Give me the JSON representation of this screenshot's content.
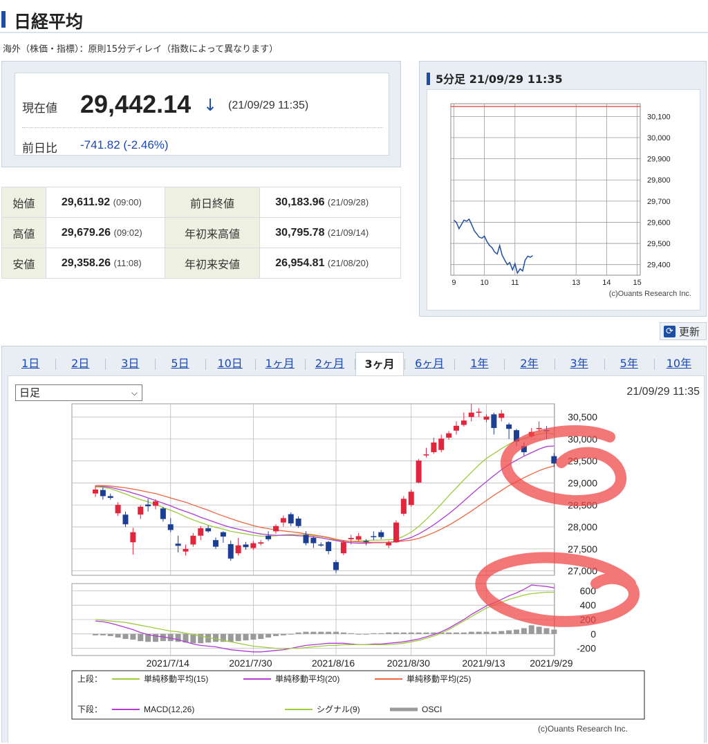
{
  "page": {
    "title": "日経平均",
    "note": "海外（株価・指標）：原則15分ディレイ（指数によって異なります）"
  },
  "quote": {
    "current_label": "現在値",
    "current_value": "29,442.14",
    "arrow": "↓",
    "current_time": "(21/09/29 11:35)",
    "change_label": "前日比",
    "change_value": "-741.82 (-2.46%)"
  },
  "stats": [
    {
      "label1": "始値",
      "value1": "29,611.92",
      "time1": "(09:00)",
      "label2": "前日終値",
      "value2": "30,183.96",
      "time2": "(21/09/28)"
    },
    {
      "label1": "高値",
      "value1": "29,679.26",
      "time1": "(09:02)",
      "label2": "年初来高値",
      "value2": "30,795.78",
      "time2": "(21/09/14)"
    },
    {
      "label1": "安値",
      "value1": "29,358.26",
      "time1": "(11:08)",
      "label2": "年初来安値",
      "value2": "26,954.81",
      "time2": "(21/08/20)"
    }
  ],
  "mini": {
    "heading": "5分足 21/09/29 11:35",
    "credit": "(c)Ouants Research Inc."
  },
  "refresh": {
    "label": "更新",
    "icon": "refresh-icon"
  },
  "tabs": [
    "1日",
    "2日",
    "3日",
    "5日",
    "10日",
    "1ヶ月",
    "2ヶ月",
    "3ヶ月",
    "6ヶ月",
    "1年",
    "2年",
    "3年",
    "5年",
    "10年"
  ],
  "active_tab": "3ヶ月",
  "main": {
    "period_select": "日足",
    "timestamp": "21/09/29 11:35",
    "legend_upper_label": "上段：",
    "legend_lower_label": "下段：",
    "legend_upper": [
      "単純移動平均(15)",
      "単純移動平均(20)",
      "単純移動平均(25)"
    ],
    "legend_lower": [
      "MACD(12,26)",
      "シグナル(9)",
      "OSCI"
    ],
    "credit": "(c)Ouants Research Inc."
  },
  "colors": {
    "up": "#e0253c",
    "down": "#1c3f94",
    "ma15": "#9ccc3c",
    "ma20": "#b13ad6",
    "ma25": "#f06440",
    "osci": "#9a9a9a",
    "annotation": "#f04a4a"
  },
  "chart_data": [
    {
      "type": "line",
      "title": "5分足 21/09/29 11:35",
      "x_ticks": [
        "9",
        "10",
        "11",
        "13",
        "14",
        "15"
      ],
      "y_ticks": [
        "30,100",
        "30,000",
        "29,900",
        "29,800",
        "29,700",
        "29,600",
        "29,500",
        "29,400"
      ],
      "ylim": [
        29350,
        30160
      ],
      "x_range": [
        8.9,
        15.1
      ],
      "reference_line": 30183.96,
      "series": [
        {
          "x": [
            9.0,
            9.08,
            9.17,
            9.25,
            9.33,
            9.42,
            9.5,
            9.58,
            9.67,
            9.75,
            9.83,
            9.92,
            10.0,
            10.08,
            10.17,
            10.25,
            10.33,
            10.42,
            10.5,
            10.58,
            10.67,
            10.75,
            10.83,
            10.92,
            11.0,
            11.08,
            11.17,
            11.25,
            11.33,
            11.42,
            11.5,
            11.58
          ],
          "y": [
            29610,
            29600,
            29570,
            29590,
            29610,
            29605,
            29615,
            29590,
            29560,
            29545,
            29530,
            29525,
            29535,
            29510,
            29490,
            29480,
            29460,
            29450,
            29490,
            29445,
            29420,
            29400,
            29410,
            29375,
            29405,
            29360,
            29380,
            29370,
            29420,
            29440,
            29435,
            29442
          ]
        }
      ]
    },
    {
      "type": "candlestick",
      "period": "日足",
      "x_tick_labels": [
        "2021/7/14",
        "2021/7/30",
        "2021/8/16",
        "2021/8/30",
        "2021/9/13",
        "2021/9/29"
      ],
      "y_ticks": [
        "30,500",
        "30,000",
        "29,500",
        "29,000",
        "28,500",
        "28,000",
        "27,500",
        "27,000"
      ],
      "ylim": [
        26900,
        30800
      ],
      "candles": [
        [
          28760,
          28850,
          28680,
          28940
        ],
        [
          28840,
          28700,
          28620,
          28900
        ],
        [
          28700,
          28660,
          28620,
          28760
        ],
        [
          28310,
          28500,
          28250,
          28560
        ],
        [
          28280,
          28060,
          28000,
          28350
        ],
        [
          27650,
          27880,
          27370,
          27980
        ],
        [
          28280,
          28460,
          28180,
          28500
        ],
        [
          28510,
          28470,
          28350,
          28640
        ],
        [
          28480,
          28580,
          28400,
          28630
        ],
        [
          28420,
          28180,
          28120,
          28460
        ],
        [
          28060,
          27930,
          27880,
          28200
        ],
        [
          27620,
          27570,
          27420,
          27800
        ],
        [
          27440,
          27500,
          27350,
          27600
        ],
        [
          27600,
          27800,
          27550,
          27860
        ],
        [
          27800,
          27970,
          27700,
          28020
        ],
        [
          27970,
          27900,
          27870,
          28030
        ],
        [
          27700,
          27550,
          27500,
          27760
        ],
        [
          27880,
          27780,
          27640,
          27900
        ],
        [
          27610,
          27280,
          27230,
          27690
        ],
        [
          27400,
          27580,
          27350,
          27750
        ],
        [
          27600,
          27540,
          27480,
          27660
        ],
        [
          27520,
          27630,
          27480,
          27680
        ],
        [
          27620,
          27650,
          27580,
          27700
        ],
        [
          27800,
          27720,
          27680,
          27900
        ],
        [
          27900,
          28020,
          27850,
          28060
        ],
        [
          28100,
          28200,
          28010,
          28260
        ],
        [
          28290,
          28080,
          28020,
          28330
        ],
        [
          28190,
          28020,
          27980,
          28240
        ],
        [
          27820,
          27630,
          27580,
          27900
        ],
        [
          27750,
          27630,
          27520,
          27790
        ],
        [
          27600,
          27580,
          27550,
          27650
        ],
        [
          27660,
          27450,
          27380,
          27680
        ],
        [
          27200,
          27020,
          26954,
          27250
        ],
        [
          27400,
          27650,
          27360,
          27700
        ],
        [
          27720,
          27750,
          27600,
          27820
        ],
        [
          27710,
          27790,
          27680,
          27860
        ],
        [
          27680,
          27660,
          27580,
          27720
        ],
        [
          27790,
          27780,
          27700,
          27900
        ],
        [
          27880,
          27770,
          27720,
          27930
        ],
        [
          27580,
          27640,
          27520,
          27690
        ],
        [
          27650,
          28100,
          27640,
          28150
        ],
        [
          28300,
          28640,
          28250,
          28700
        ],
        [
          28500,
          28800,
          28460,
          28850
        ],
        [
          29010,
          29510,
          28990,
          29550
        ],
        [
          29630,
          29650,
          29580,
          29800
        ],
        [
          29700,
          29920,
          29660,
          30030
        ],
        [
          29750,
          30010,
          29700,
          30100
        ],
        [
          30030,
          30130,
          29980,
          30180
        ],
        [
          30190,
          30300,
          30100,
          30400
        ],
        [
          30320,
          30420,
          30280,
          30600
        ],
        [
          30500,
          30600,
          30400,
          30795
        ],
        [
          30600,
          30620,
          30500,
          30700
        ],
        [
          30440,
          30510,
          30380,
          30560
        ],
        [
          30560,
          30250,
          30100,
          30600
        ],
        [
          30480,
          30580,
          30400,
          30660
        ],
        [
          30330,
          30230,
          30000,
          30370
        ],
        [
          30200,
          29940,
          29840,
          30230
        ],
        [
          29840,
          29700,
          29620,
          29920
        ],
        [
          30060,
          30160,
          30030,
          30250
        ],
        [
          30230,
          30250,
          30160,
          30400
        ],
        [
          30200,
          30180,
          30000,
          30290
        ],
        [
          29610,
          29442,
          29358,
          29680
        ]
      ],
      "moving_averages": {
        "単純移動平均(15)": [
          28910,
          28900,
          28870,
          28810,
          28750,
          28680,
          28620,
          28570,
          28510,
          28440,
          28380,
          28310,
          28230,
          28160,
          28100,
          28040,
          27990,
          27950,
          27900,
          27870,
          27840,
          27810,
          27790,
          27790,
          27800,
          27820,
          27830,
          27830,
          27820,
          27800,
          27780,
          27750,
          27700,
          27680,
          27670,
          27680,
          27690,
          27700,
          27700,
          27710,
          27720,
          27790,
          27880,
          28010,
          28170,
          28340,
          28520,
          28710,
          28890,
          29070,
          29240,
          29410,
          29560,
          29670,
          29780,
          29880,
          29960,
          30010,
          30060,
          30110,
          30140,
          30110
        ],
        "単純移動平均(20)": [
          28930,
          28920,
          28900,
          28860,
          28820,
          28770,
          28720,
          28660,
          28600,
          28540,
          28480,
          28410,
          28350,
          28290,
          28220,
          28160,
          28100,
          28040,
          27990,
          27950,
          27910,
          27870,
          27840,
          27820,
          27810,
          27810,
          27810,
          27800,
          27790,
          27770,
          27750,
          27720,
          27690,
          27660,
          27640,
          27630,
          27630,
          27640,
          27640,
          27650,
          27670,
          27710,
          27760,
          27840,
          27940,
          28050,
          28170,
          28300,
          28440,
          28590,
          28740,
          28890,
          29030,
          29170,
          29300,
          29420,
          29520,
          29610,
          29690,
          29770,
          29830,
          29840
        ],
        "単純移動平均(25)": [
          28940,
          28940,
          28930,
          28910,
          28890,
          28860,
          28830,
          28790,
          28760,
          28710,
          28660,
          28610,
          28560,
          28500,
          28440,
          28380,
          28310,
          28250,
          28190,
          28130,
          28080,
          28030,
          27990,
          27960,
          27930,
          27910,
          27890,
          27870,
          27840,
          27820,
          27790,
          27760,
          27720,
          27690,
          27670,
          27660,
          27650,
          27650,
          27650,
          27650,
          27660,
          27680,
          27700,
          27740,
          27800,
          27870,
          27950,
          28040,
          28140,
          28250,
          28360,
          28480,
          28600,
          28720,
          28830,
          28940,
          29030,
          29120,
          29200,
          29280,
          29340,
          29390
        ]
      }
    },
    {
      "type": "line",
      "title": "",
      "y_ticks": [
        "600",
        "400",
        "200",
        "0",
        "-200"
      ],
      "ylim": [
        -300,
        700
      ],
      "macd": [
        180,
        170,
        150,
        120,
        90,
        60,
        20,
        -10,
        -30,
        -40,
        -60,
        -80,
        -110,
        -140,
        -160,
        -170,
        -180,
        -200,
        -220,
        -230,
        -240,
        -250,
        -250,
        -240,
        -230,
        -220,
        -200,
        -180,
        -160,
        -150,
        -140,
        -130,
        -130,
        -130,
        -140,
        -150,
        -150,
        -140,
        -140,
        -130,
        -120,
        -110,
        -90,
        -70,
        -40,
        -10,
        30,
        80,
        140,
        200,
        270,
        330,
        390,
        430,
        480,
        530,
        570,
        620,
        680,
        670,
        660,
        640
      ],
      "signal": [
        200,
        190,
        180,
        170,
        160,
        140,
        120,
        100,
        80,
        60,
        40,
        30,
        10,
        -10,
        -30,
        -50,
        -70,
        -90,
        -110,
        -130,
        -150,
        -170,
        -180,
        -190,
        -200,
        -200,
        -200,
        -200,
        -190,
        -180,
        -170,
        -160,
        -160,
        -150,
        -150,
        -150,
        -150,
        -150,
        -150,
        -150,
        -140,
        -130,
        -110,
        -90,
        -60,
        -30,
        10,
        60,
        120,
        180,
        240,
        300,
        360,
        400,
        440,
        480,
        510,
        540,
        560,
        570,
        580,
        580
      ],
      "osci": [
        -20,
        -20,
        -30,
        -50,
        -70,
        -80,
        -100,
        -110,
        -110,
        -100,
        -100,
        -110,
        -120,
        -130,
        -130,
        -120,
        -110,
        -110,
        -110,
        -100,
        -90,
        -80,
        -70,
        -50,
        -30,
        -20,
        0,
        20,
        30,
        30,
        30,
        30,
        30,
        20,
        10,
        0,
        0,
        10,
        10,
        20,
        20,
        20,
        20,
        20,
        20,
        20,
        20,
        20,
        20,
        20,
        30,
        30,
        30,
        30,
        40,
        50,
        60,
        80,
        120,
        100,
        80,
        60
      ]
    }
  ]
}
